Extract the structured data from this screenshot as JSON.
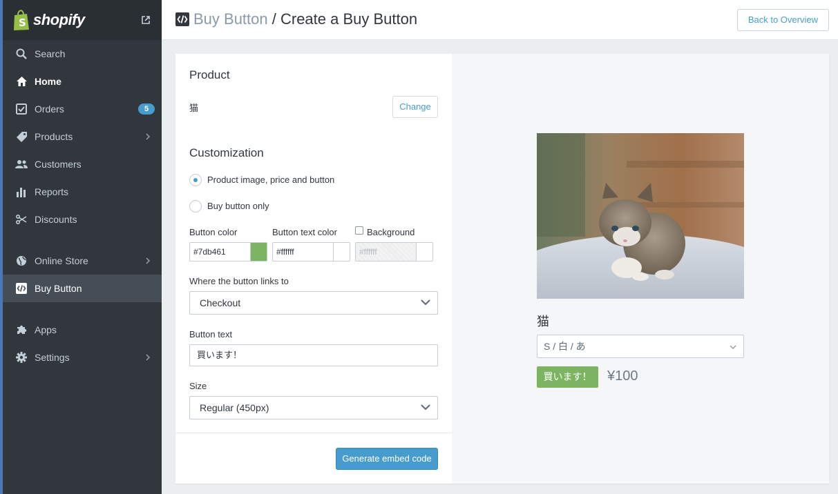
{
  "brand": {
    "name": "shopify"
  },
  "sidebar": {
    "items": [
      {
        "label": "Search",
        "icon": "search-icon"
      },
      {
        "label": "Home",
        "icon": "home-icon"
      },
      {
        "label": "Orders",
        "icon": "orders-icon",
        "badge": "5"
      },
      {
        "label": "Products",
        "icon": "tag-icon"
      },
      {
        "label": "Customers",
        "icon": "customers-icon"
      },
      {
        "label": "Reports",
        "icon": "reports-icon"
      },
      {
        "label": "Discounts",
        "icon": "discount-icon"
      },
      {
        "label": "Online Store",
        "icon": "globe-icon"
      },
      {
        "label": "Buy Button",
        "icon": "code-icon"
      },
      {
        "label": "Apps",
        "icon": "puzzle-icon"
      },
      {
        "label": "Settings",
        "icon": "gear-icon"
      }
    ]
  },
  "header": {
    "breadcrumb": "Buy Button",
    "separator": " / ",
    "title": "Create a Buy Button",
    "back_label": "Back to Overview"
  },
  "form": {
    "product_heading": "Product",
    "product_name": "猫",
    "change_label": "Change",
    "customization_heading": "Customization",
    "layout_options": [
      "Product image, price and button",
      "Buy button only"
    ],
    "layout_selected": 0,
    "button_color_label": "Button color",
    "button_color_value": "#7db461",
    "button_text_color_label": "Button text color",
    "button_text_color_value": "#ffffff",
    "background_label": "Background",
    "background_value": "#ffffff",
    "background_checked": false,
    "links_to_label": "Where the button links to",
    "links_to_value": "Checkout",
    "button_text_label": "Button text",
    "button_text_value": "買います！",
    "size_label": "Size",
    "size_value": "Regular (450px)",
    "generate_label": "Generate embed code"
  },
  "preview": {
    "title": "猫",
    "variant": "S / 白 / あ",
    "buy_label": "買います！",
    "price": "¥100"
  },
  "colors": {
    "accent": "#479ccf",
    "button": "#7db461",
    "sidebar": "#31373d"
  }
}
